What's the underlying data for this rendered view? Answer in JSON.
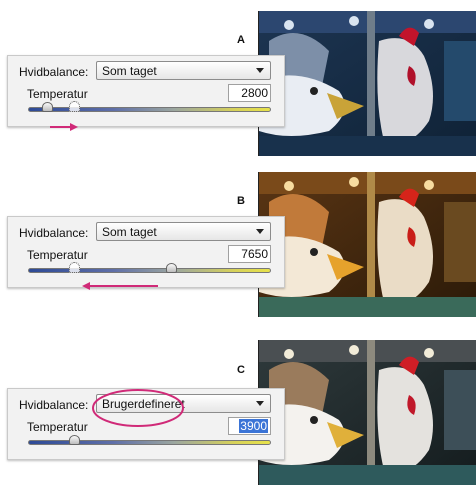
{
  "colors": {
    "annotation": "#d02a78",
    "selection": "#3b74d6",
    "track_cool": "#2d4a96",
    "track_warm": "#e7e24a"
  },
  "sections": [
    {
      "letter": "A",
      "white_balance_label": "Hvidbalance:",
      "white_balance_value": "Som taget",
      "temperature_label": "Temperatur",
      "temperature_value": "2800",
      "slider_level_percent": 8,
      "ghost_thumb_level_percent": 19,
      "value_selected": false,
      "annotation": "arrow-right",
      "photo_tint": "cool"
    },
    {
      "letter": "B",
      "white_balance_label": "Hvidbalance:",
      "white_balance_value": "Som taget",
      "temperature_label": "Temperatur",
      "temperature_value": "7650",
      "slider_level_percent": 59,
      "ghost_thumb_level_percent": 19,
      "value_selected": false,
      "annotation": "arrow-left",
      "photo_tint": "warm"
    },
    {
      "letter": "C",
      "white_balance_label": "Hvidbalance:",
      "white_balance_value": "Brugerdefineret",
      "temperature_label": "Temperatur",
      "temperature_value": "3900",
      "slider_level_percent": 19,
      "ghost_thumb_level_percent": null,
      "value_selected": true,
      "annotation": "ellipse-around-dropdown",
      "photo_tint": "neutral"
    }
  ]
}
